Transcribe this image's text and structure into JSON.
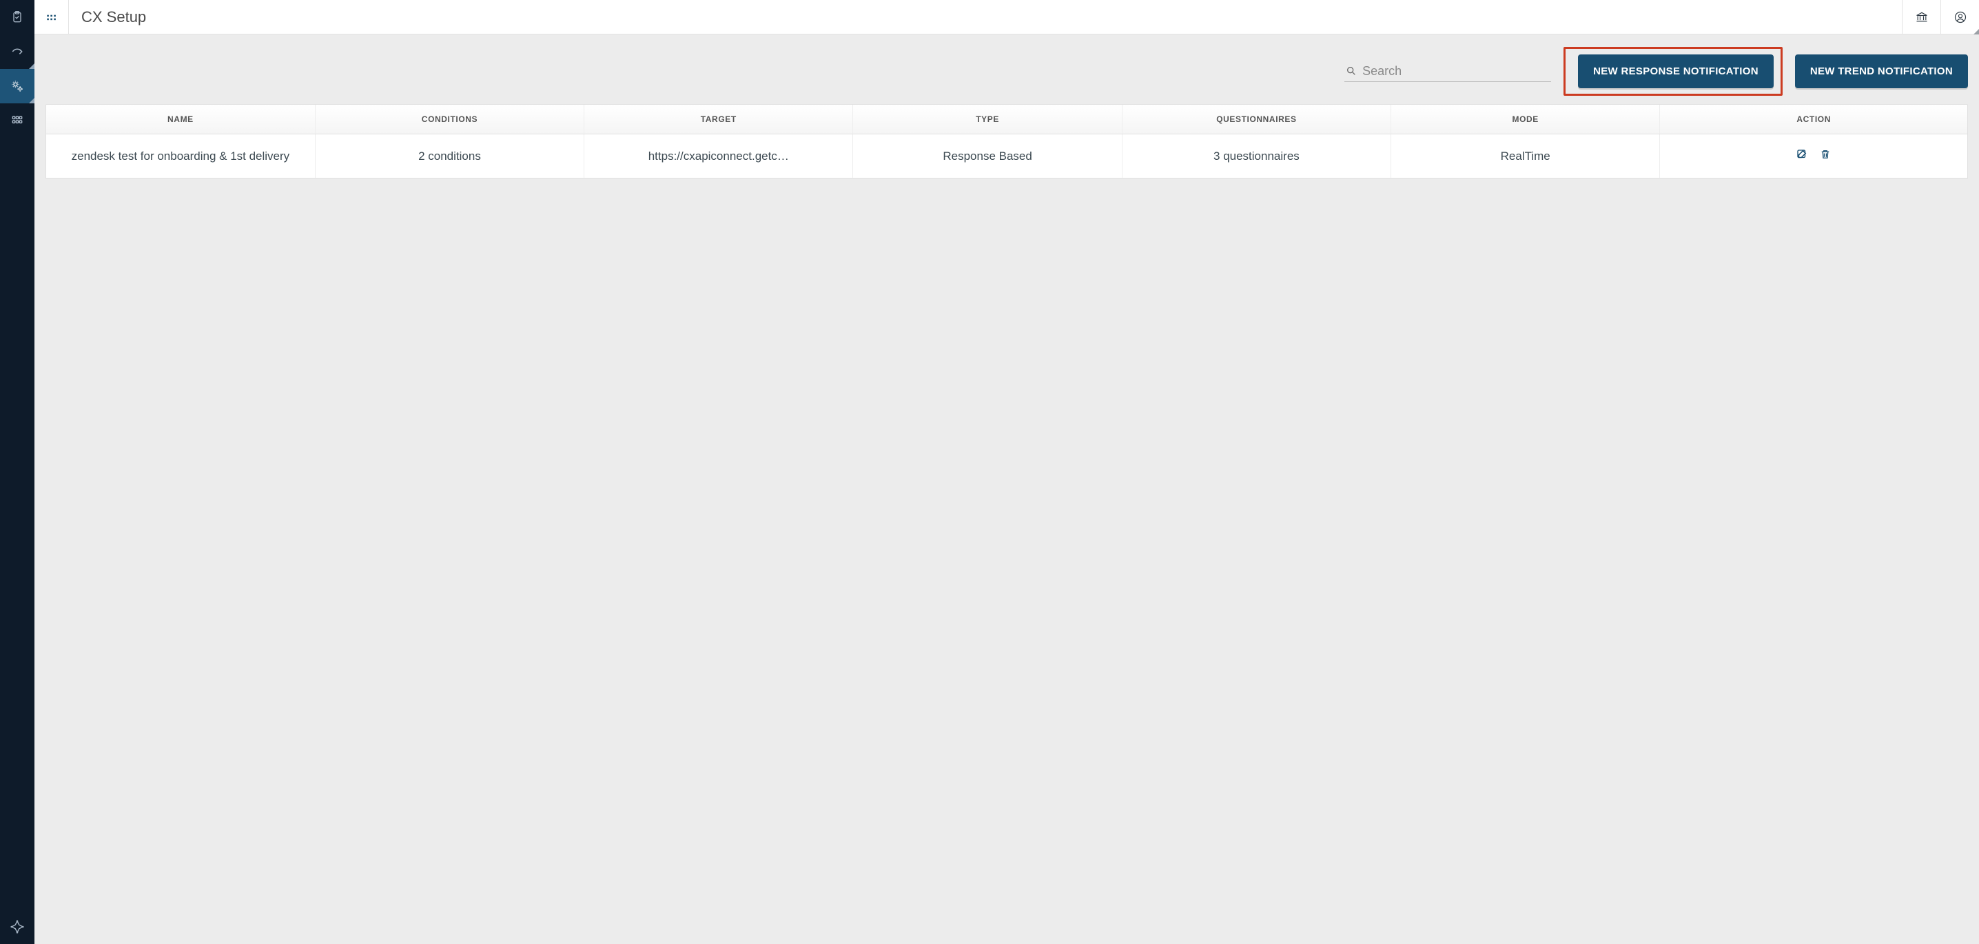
{
  "header": {
    "title": "CX Setup"
  },
  "search": {
    "placeholder": "Search",
    "value": ""
  },
  "buttons": {
    "new_response": "NEW RESPONSE NOTIFICATION",
    "new_trend": "NEW TREND NOTIFICATION"
  },
  "table": {
    "headers": {
      "name": "NAME",
      "conditions": "CONDITIONS",
      "target": "TARGET",
      "type": "TYPE",
      "questionnaires": "QUESTIONNAIRES",
      "mode": "MODE",
      "action": "ACTION"
    },
    "rows": [
      {
        "name": "zendesk test for onboarding & 1st delivery",
        "conditions": "2 conditions",
        "target": "https://cxapiconnect.getc…",
        "type": "Response Based",
        "questionnaires": "3 questionnaires",
        "mode": "RealTime"
      }
    ]
  },
  "icons": {
    "sidebar": [
      "clipboard-icon",
      "share-icon",
      "settings-gear-icon",
      "apps-grid-icon"
    ],
    "logo": "logo-icon",
    "top": [
      "bank-icon",
      "user-circle-icon"
    ]
  },
  "colors": {
    "sidebar_bg": "#0e1b2a",
    "sidebar_active": "#1e5478",
    "primary_button": "#184e71",
    "content_bg": "#ececec",
    "highlight_border": "#cc3b21"
  }
}
